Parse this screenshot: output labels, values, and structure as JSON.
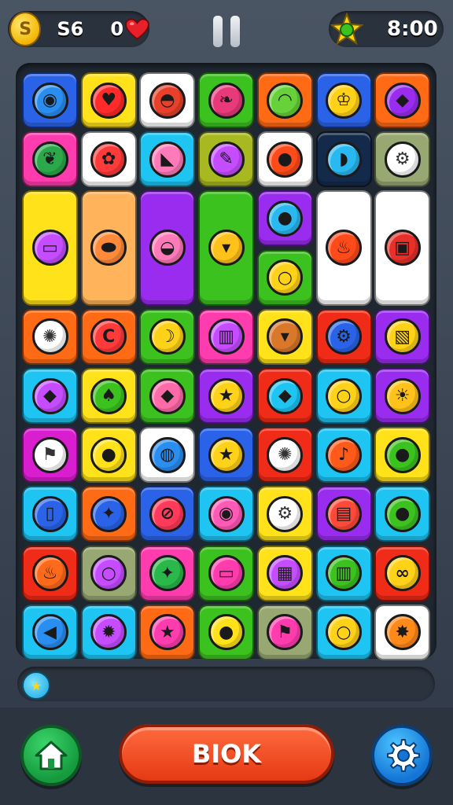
{
  "hud": {
    "coin_icon": "coin-icon",
    "coins": "S6",
    "lives": "0",
    "lives_icon": "heart-icon",
    "pause_icon": "pause-icon",
    "star_icon": "star-icon",
    "timer": "8:00"
  },
  "tray": {
    "slot_icon": "star-token-icon"
  },
  "footer": {
    "home_icon": "home-icon",
    "action_label": "BIOK",
    "settings_icon": "gear-icon"
  },
  "colors": {
    "blue": "#2b63e8",
    "yellow": "#ffe21a",
    "white": "#ffffff",
    "green": "#3cc21f",
    "orange": "#ff6a14",
    "cyan": "#1ec4f2",
    "red": "#f02b17",
    "pink": "#ff3cae",
    "purple": "#9a2cf0",
    "olive": "#a8b820",
    "navy": "#142a4a",
    "sage": "#97a873",
    "peach": "#ffb35a",
    "magenta": "#d91ed0"
  },
  "tiles": [
    {
      "row": 0,
      "col": 0,
      "rs": 1,
      "color": "blue",
      "icon": "location-pin-icon",
      "ic": "#2a8ef0"
    },
    {
      "row": 0,
      "col": 1,
      "rs": 1,
      "color": "yellow",
      "icon": "heart-icon",
      "ic": "#ff2a2a"
    },
    {
      "row": 0,
      "col": 2,
      "rs": 1,
      "color": "white",
      "icon": "sunglasses-hat-icon",
      "ic": "#e8402a"
    },
    {
      "row": 0,
      "col": 3,
      "rs": 1,
      "color": "green",
      "icon": "leaf-badge-icon",
      "ic": "#e83a7a"
    },
    {
      "row": 0,
      "col": 4,
      "rs": 1,
      "color": "orange",
      "icon": "turtle-icon",
      "ic": "#67d13a"
    },
    {
      "row": 0,
      "col": 5,
      "rs": 1,
      "color": "blue",
      "icon": "trophy-icon",
      "ic": "#ffd21a"
    },
    {
      "row": 0,
      "col": 6,
      "rs": 1,
      "color": "orange",
      "icon": "kite-icon",
      "ic": "#9a2cf0"
    },
    {
      "row": 1,
      "col": 0,
      "rs": 1,
      "color": "pink",
      "icon": "leaf-icon",
      "ic": "#2aa84a"
    },
    {
      "row": 1,
      "col": 1,
      "rs": 1,
      "color": "white",
      "icon": "flower-icon",
      "ic": "#ff3a3a"
    },
    {
      "row": 1,
      "col": 2,
      "rs": 1,
      "color": "cyan",
      "icon": "cake-slice-icon",
      "ic": "#ff7ab8"
    },
    {
      "row": 1,
      "col": 3,
      "rs": 1,
      "color": "olive",
      "icon": "pencil-icon",
      "ic": "#c64dff"
    },
    {
      "row": 1,
      "col": 4,
      "rs": 1,
      "color": "white",
      "icon": "tomato-icon",
      "ic": "#ff4a1a"
    },
    {
      "row": 1,
      "col": 5,
      "rs": 1,
      "color": "navy",
      "icon": "bird-icon",
      "ic": "#2ab8f0"
    },
    {
      "row": 1,
      "col": 6,
      "rs": 1,
      "color": "sage",
      "icon": "gear-icon",
      "ic": "#ffffff"
    },
    {
      "row": 2,
      "col": 0,
      "rs": 2,
      "color": "yellow",
      "icon": "radio-icon",
      "ic": "#c64dff"
    },
    {
      "row": 2,
      "col": 1,
      "rs": 2,
      "color": "peach",
      "icon": "seed-icon",
      "ic": "#ff8a3a"
    },
    {
      "row": 2,
      "col": 2,
      "rs": 2,
      "color": "purple",
      "icon": "pot-icon",
      "ic": "#ff7ab8"
    },
    {
      "row": 2,
      "col": 3,
      "rs": 2,
      "color": "green",
      "icon": "cup-icon",
      "ic": "#ffc21a"
    },
    {
      "row": 2,
      "col": 4,
      "rs": 1,
      "color": "purple",
      "icon": "chat-bubble-icon",
      "ic": "#2ab8f0"
    },
    {
      "row": 3,
      "col": 4,
      "rs": 1,
      "color": "green",
      "icon": "ring-icon",
      "ic": "#ffd21a"
    },
    {
      "row": 2,
      "col": 5,
      "rs": 2,
      "color": "white",
      "icon": "fire-icon",
      "ic": "#ff4a1a"
    },
    {
      "row": 2,
      "col": 6,
      "rs": 2,
      "color": "white",
      "icon": "gift-box-icon",
      "ic": "#e8302a"
    },
    {
      "row": 4,
      "col": 0,
      "rs": 1,
      "color": "orange",
      "icon": "virus-icon",
      "ic": "#ffffff"
    },
    {
      "row": 4,
      "col": 1,
      "rs": 1,
      "color": "orange",
      "icon": "c-badge-icon",
      "ic": "#ff3a3a"
    },
    {
      "row": 4,
      "col": 2,
      "rs": 1,
      "color": "green",
      "icon": "banana-icon",
      "ic": "#ffd21a"
    },
    {
      "row": 4,
      "col": 3,
      "rs": 1,
      "color": "pink",
      "icon": "trash-can-icon",
      "ic": "#c64dff"
    },
    {
      "row": 4,
      "col": 4,
      "rs": 1,
      "color": "yellow",
      "icon": "plant-pot-icon",
      "ic": "#d9772a"
    },
    {
      "row": 4,
      "col": 5,
      "rs": 1,
      "color": "red",
      "icon": "gear-icon",
      "ic": "#2a63e8"
    },
    {
      "row": 4,
      "col": 6,
      "rs": 1,
      "color": "purple",
      "icon": "book-icon",
      "ic": "#ffd21a"
    },
    {
      "row": 5,
      "col": 0,
      "rs": 1,
      "color": "cyan",
      "icon": "tag-icon",
      "ic": "#c64dff"
    },
    {
      "row": 5,
      "col": 1,
      "rs": 1,
      "color": "yellow",
      "icon": "mushroom-icon",
      "ic": "#3cc21f"
    },
    {
      "row": 5,
      "col": 2,
      "rs": 1,
      "color": "green",
      "icon": "kite-icon",
      "ic": "#ff6aa8"
    },
    {
      "row": 5,
      "col": 3,
      "rs": 1,
      "color": "purple",
      "icon": "star-icon",
      "ic": "#ffd21a"
    },
    {
      "row": 5,
      "col": 4,
      "rs": 1,
      "color": "red",
      "icon": "gem-icon",
      "ic": "#1ec4f2"
    },
    {
      "row": 5,
      "col": 5,
      "rs": 1,
      "color": "cyan",
      "icon": "ring-icon",
      "ic": "#ffd21a"
    },
    {
      "row": 5,
      "col": 6,
      "rs": 1,
      "color": "purple",
      "icon": "sun-icon",
      "ic": "#ffc21a"
    },
    {
      "row": 6,
      "col": 0,
      "rs": 1,
      "color": "magenta",
      "icon": "flag-icon",
      "ic": "#ffffff"
    },
    {
      "row": 6,
      "col": 1,
      "rs": 1,
      "color": "yellow",
      "icon": "lemon-icon",
      "ic": "#ffe21a"
    },
    {
      "row": 6,
      "col": 2,
      "rs": 1,
      "color": "white",
      "icon": "globe-icon",
      "ic": "#2a8ef0"
    },
    {
      "row": 6,
      "col": 3,
      "rs": 1,
      "color": "blue",
      "icon": "star-icon",
      "ic": "#ffd21a"
    },
    {
      "row": 6,
      "col": 4,
      "rs": 1,
      "color": "red",
      "icon": "virus-icon",
      "ic": "#ffffff"
    },
    {
      "row": 6,
      "col": 5,
      "rs": 1,
      "color": "cyan",
      "icon": "bell-icon",
      "ic": "#ff5a1a"
    },
    {
      "row": 6,
      "col": 6,
      "rs": 1,
      "color": "yellow",
      "icon": "bomb-icon",
      "ic": "#3cc21f"
    },
    {
      "row": 7,
      "col": 0,
      "rs": 1,
      "color": "cyan",
      "icon": "tablet-icon",
      "ic": "#2a63e8"
    },
    {
      "row": 7,
      "col": 1,
      "rs": 1,
      "color": "orange",
      "icon": "compass-icon",
      "ic": "#2a63e8"
    },
    {
      "row": 7,
      "col": 2,
      "rs": 1,
      "color": "blue",
      "icon": "no-sign-icon",
      "ic": "#ff3a5a"
    },
    {
      "row": 7,
      "col": 3,
      "rs": 1,
      "color": "cyan",
      "icon": "lollipop-icon",
      "ic": "#ff5ab8"
    },
    {
      "row": 7,
      "col": 4,
      "rs": 1,
      "color": "yellow",
      "icon": "gear-icon",
      "ic": "#ffffff"
    },
    {
      "row": 7,
      "col": 5,
      "rs": 1,
      "color": "purple",
      "icon": "box-icon",
      "ic": "#ff4a3a"
    },
    {
      "row": 7,
      "col": 6,
      "rs": 1,
      "color": "cyan",
      "icon": "apple-icon",
      "ic": "#3cc21f"
    },
    {
      "row": 8,
      "col": 0,
      "rs": 1,
      "color": "red",
      "icon": "flame-icon",
      "ic": "#ff6a1a"
    },
    {
      "row": 8,
      "col": 1,
      "rs": 1,
      "color": "sage",
      "icon": "ring-icon",
      "ic": "#c64dff"
    },
    {
      "row": 8,
      "col": 2,
      "rs": 1,
      "color": "pink",
      "icon": "compass-icon",
      "ic": "#2ab84a"
    },
    {
      "row": 8,
      "col": 3,
      "rs": 1,
      "color": "green",
      "icon": "jar-icon",
      "ic": "#ff3cae"
    },
    {
      "row": 8,
      "col": 4,
      "rs": 1,
      "color": "yellow",
      "icon": "package-icon",
      "ic": "#c64dff"
    },
    {
      "row": 8,
      "col": 5,
      "rs": 1,
      "color": "cyan",
      "icon": "suitcase-icon",
      "ic": "#3cc21f"
    },
    {
      "row": 8,
      "col": 6,
      "rs": 1,
      "color": "red",
      "icon": "knot-icon",
      "ic": "#ffd21a"
    },
    {
      "row": 9,
      "col": 0,
      "rs": 1,
      "color": "cyan",
      "icon": "fish-icon",
      "ic": "#2a8ef0"
    },
    {
      "row": 9,
      "col": 1,
      "rs": 1,
      "color": "cyan",
      "icon": "splat-icon",
      "ic": "#c64dff"
    },
    {
      "row": 9,
      "col": 2,
      "rs": 1,
      "color": "orange",
      "icon": "star-icon",
      "ic": "#ff3cae"
    },
    {
      "row": 9,
      "col": 3,
      "rs": 1,
      "color": "green",
      "icon": "lemon-icon",
      "ic": "#ffe21a"
    },
    {
      "row": 9,
      "col": 4,
      "rs": 1,
      "color": "sage",
      "icon": "flag-icon",
      "ic": "#ff3cae"
    },
    {
      "row": 9,
      "col": 5,
      "rs": 1,
      "color": "cyan",
      "icon": "ring-icon",
      "ic": "#ffd21a"
    },
    {
      "row": 9,
      "col": 6,
      "rs": 1,
      "color": "white",
      "icon": "sunflower-icon",
      "ic": "#ff8a1a"
    }
  ]
}
